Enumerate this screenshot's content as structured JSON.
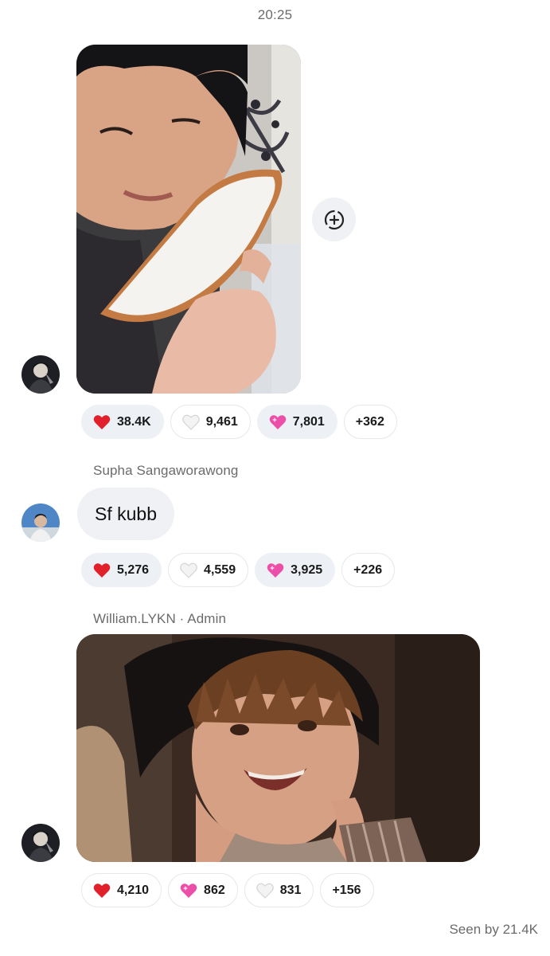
{
  "timestamp": "20:25",
  "messages": [
    {
      "type": "image",
      "avatar": "dark-hair-avatar",
      "add_reaction_icon": "add-reaction-icon",
      "reactions": [
        {
          "emoji": "red-heart",
          "color": "#e0202b",
          "count": "38.4K"
        },
        {
          "emoji": "white-heart",
          "color": "#eeeeee",
          "count": "9,461"
        },
        {
          "emoji": "sparkling-pink-heart",
          "color": "#ec4fa8",
          "count": "7,801"
        },
        {
          "emoji": null,
          "count": "+362"
        }
      ]
    },
    {
      "type": "text",
      "sender": "Supha Sangaworawong",
      "avatar": "blue-sky-avatar",
      "text": "Sf kubb",
      "reactions": [
        {
          "emoji": "red-heart",
          "color": "#e0202b",
          "count": "5,276"
        },
        {
          "emoji": "white-heart",
          "color": "#eeeeee",
          "count": "4,559"
        },
        {
          "emoji": "sparkling-pink-heart",
          "color": "#ec4fa8",
          "count": "3,925"
        },
        {
          "emoji": null,
          "count": "+226"
        }
      ]
    },
    {
      "type": "image",
      "sender": "William.LYKN · Admin",
      "avatar": "dark-hair-avatar",
      "reactions": [
        {
          "emoji": "red-heart",
          "color": "#e0202b",
          "count": "4,210"
        },
        {
          "emoji": "sparkling-pink-heart",
          "color": "#ec4fa8",
          "count": "862"
        },
        {
          "emoji": "white-heart",
          "color": "#eeeeee",
          "count": "831"
        },
        {
          "emoji": null,
          "count": "+156"
        }
      ]
    }
  ],
  "seen": "Seen by 21.4K",
  "colors": {
    "chip_active_bg": "#edf0f5",
    "bubble_bg": "#f0f1f4",
    "meta_text": "#6b6b6b"
  }
}
